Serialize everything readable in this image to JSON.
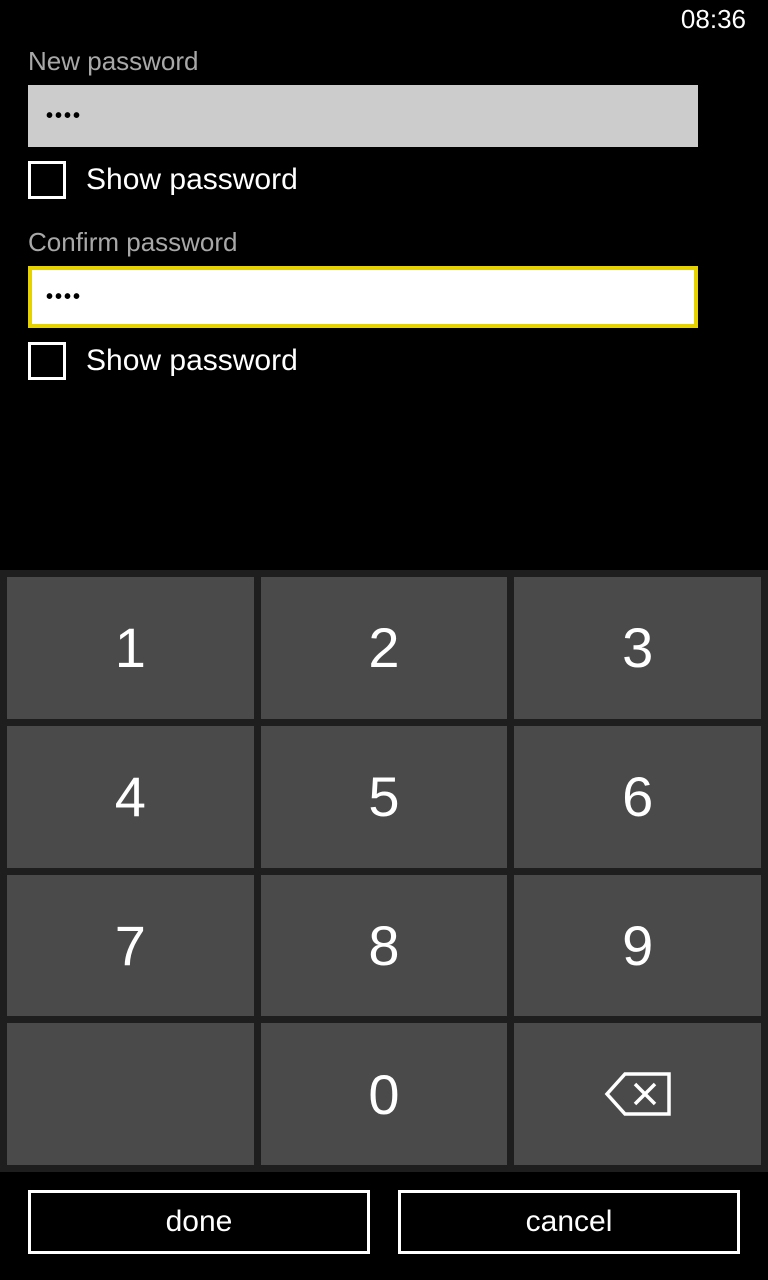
{
  "status": {
    "time": "08:36"
  },
  "form": {
    "new_label": "New password",
    "new_value_masked": "••••",
    "new_show_label": "Show password",
    "confirm_label": "Confirm password",
    "confirm_value_masked": "••••",
    "confirm_show_label": "Show password"
  },
  "keypad": {
    "keys": [
      "1",
      "2",
      "3",
      "4",
      "5",
      "6",
      "7",
      "8",
      "9",
      "",
      "0",
      "backspace"
    ]
  },
  "bottom": {
    "done_label": "done",
    "cancel_label": "cancel"
  }
}
